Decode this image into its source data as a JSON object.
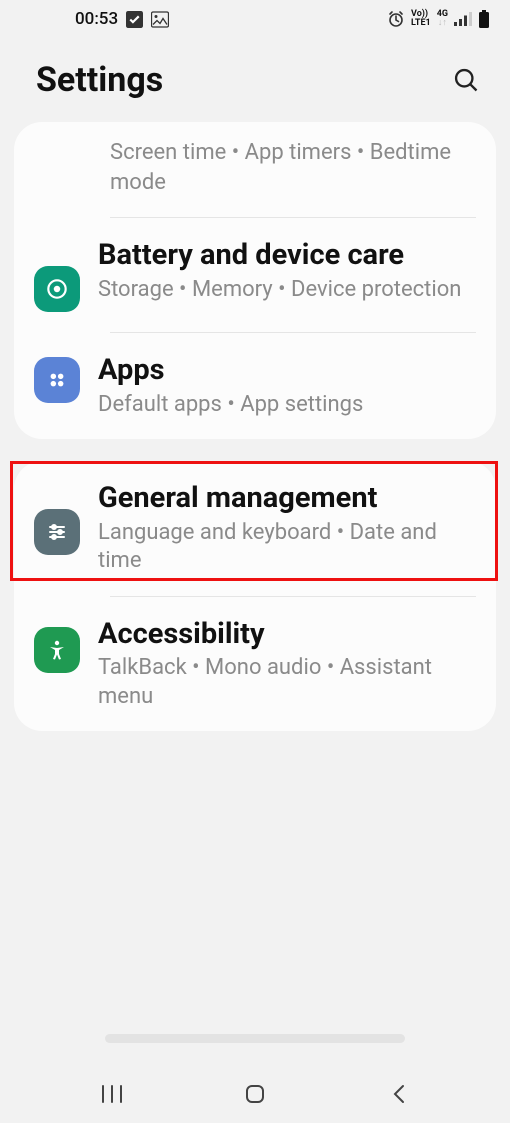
{
  "status": {
    "time": "00:53",
    "net_top": "Vo))",
    "net_bottom": "LTE1",
    "net_gen": "4G"
  },
  "header": {
    "title": "Settings"
  },
  "card1": {
    "r0_sub": "Screen time  •  App timers  •  Bedtime mode",
    "r1_title": "Battery and device care",
    "r1_sub": "Storage  •  Memory  •  Device protection",
    "r2_title": "Apps",
    "r2_sub": "Default apps  •  App settings"
  },
  "card2": {
    "r0_title": "General management",
    "r0_sub": "Language and keyboard  •  Date and time",
    "r1_title": "Accessibility",
    "r1_sub": "TalkBack  •  Mono audio  •  Assistant menu"
  },
  "colors": {
    "care": "#0c9a7a",
    "apps": "#5b83d6",
    "general": "#5b7078",
    "access": "#1f9a52"
  }
}
